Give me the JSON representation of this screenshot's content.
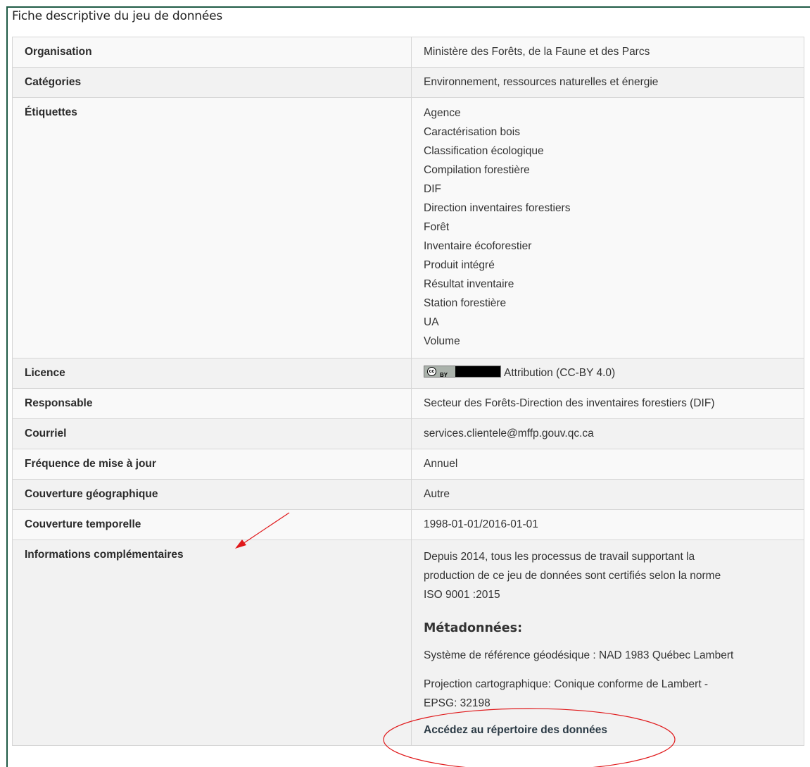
{
  "panel": {
    "title": "Fiche descriptive du jeu de données"
  },
  "rows": {
    "organisation": {
      "label": "Organisation",
      "value": "Ministère des Forêts, de la Faune et des Parcs"
    },
    "categories": {
      "label": "Catégories",
      "value": "Environnement, ressources naturelles et énergie"
    },
    "etiquettes": {
      "label": "Étiquettes",
      "tags": [
        "Agence",
        "Caractérisation bois",
        "Classification écologique",
        "Compilation forestière",
        "DIF",
        "Direction inventaires forestiers",
        "Forêt",
        "Inventaire écoforestier",
        "Produit intégré",
        "Résultat inventaire",
        "Station forestière",
        "UA",
        "Volume"
      ]
    },
    "licence": {
      "label": "Licence",
      "badge_text": "cc by",
      "value": "Attribution (CC-BY 4.0)"
    },
    "responsable": {
      "label": "Responsable",
      "value": "Secteur des Forêts-Direction des inventaires forestiers (DIF)"
    },
    "courriel": {
      "label": "Courriel",
      "value": "services.clientele@mffp.gouv.qc.ca"
    },
    "frequence": {
      "label": "Fréquence de mise à jour",
      "value": "Annuel"
    },
    "couverture_geo": {
      "label": "Couverture géographique",
      "value": "Autre"
    },
    "couverture_temp": {
      "label": "Couverture temporelle",
      "value": "1998-01-01/2016-01-01"
    },
    "infos": {
      "label": "Informations complémentaires",
      "paragraph_lines": [
        "Depuis 2014, tous les processus de travail supportant la",
        "production de ce jeu de données sont certifiés selon la norme",
        "ISO 9001 :2015"
      ],
      "metadata_heading": "Métadonnées:",
      "metadata_line1": "Système de référence géodésique : NAD 1983 Québec Lambert",
      "metadata_line2a": "Projection cartographique: Conique conforme de Lambert -",
      "metadata_line2b": "EPSG: 32198",
      "access_link": "Accédez au répertoire des données"
    }
  },
  "annotations": {
    "color": "#e0191b"
  }
}
